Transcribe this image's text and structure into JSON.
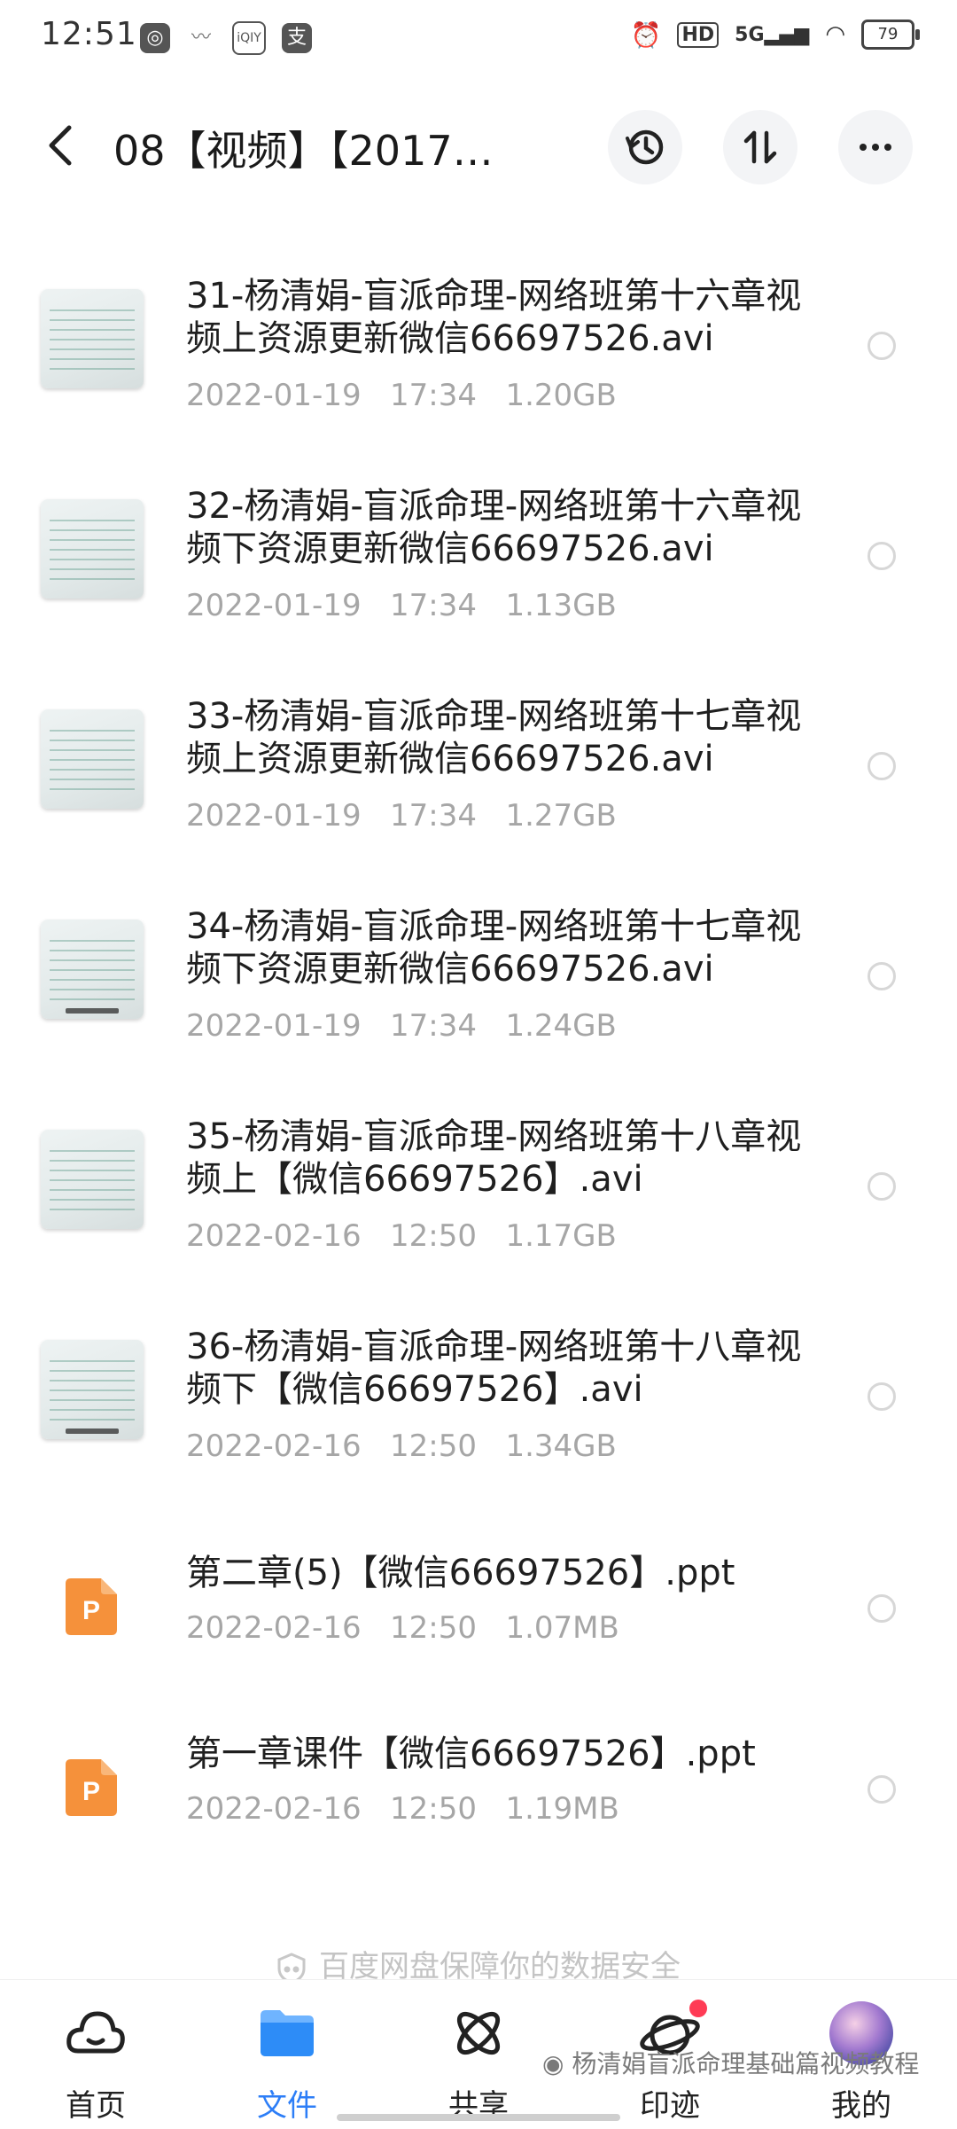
{
  "status_bar": {
    "time": "12:51",
    "left_icons": [
      "app-icon",
      "wave-icon",
      "iqiyi-icon",
      "alipay-icon"
    ],
    "network": "5G",
    "hd_label": "HD",
    "battery": "79"
  },
  "header": {
    "title": "08【视频】【2017…",
    "actions": [
      "history-icon",
      "sort-icon",
      "more-icon"
    ]
  },
  "files": [
    {
      "name": "31-杨清娟-盲派命理-网络班第十六章视频上资源更新微信66697526.avi",
      "date": "2022-01-19",
      "time": "17:34",
      "size": "1.20GB",
      "type": "video"
    },
    {
      "name": "32-杨清娟-盲派命理-网络班第十六章视频下资源更新微信66697526.avi",
      "date": "2022-01-19",
      "time": "17:34",
      "size": "1.13GB",
      "type": "video"
    },
    {
      "name": "33-杨清娟-盲派命理-网络班第十七章视频上资源更新微信66697526.avi",
      "date": "2022-01-19",
      "time": "17:34",
      "size": "1.27GB",
      "type": "video"
    },
    {
      "name": "34-杨清娟-盲派命理-网络班第十七章视频下资源更新微信66697526.avi",
      "date": "2022-01-19",
      "time": "17:34",
      "size": "1.24GB",
      "type": "video"
    },
    {
      "name": "35-杨清娟-盲派命理-网络班第十八章视频上【微信66697526】.avi",
      "date": "2022-02-16",
      "time": "12:50",
      "size": "1.17GB",
      "type": "video"
    },
    {
      "name": "36-杨清娟-盲派命理-网络班第十八章视频下【微信66697526】.avi",
      "date": "2022-02-16",
      "time": "12:50",
      "size": "1.34GB",
      "type": "video"
    },
    {
      "name": "第二章(5)【微信66697526】.ppt",
      "date": "2022-02-16",
      "time": "12:50",
      "size": "1.07MB",
      "type": "ppt"
    },
    {
      "name": "第一章课件【微信66697526】.ppt",
      "date": "2022-02-16",
      "time": "12:50",
      "size": "1.19MB",
      "type": "ppt"
    }
  ],
  "safety_text": "百度网盘保障你的数据安全",
  "nav": [
    {
      "label": "首页",
      "icon": "home-cloud-icon",
      "active": false
    },
    {
      "label": "文件",
      "icon": "folder-icon",
      "active": true
    },
    {
      "label": "共享",
      "icon": "share-atom-icon",
      "active": false
    },
    {
      "label": "印迹",
      "icon": "planet-icon",
      "active": false
    },
    {
      "label": "我的",
      "icon": "avatar",
      "active": false
    }
  ],
  "watermark": "杨清娟盲派命理基础篇视频教程",
  "colors": {
    "accent": "#2d7ef7",
    "ppt": "#f5913b",
    "meta": "#a6a6a6",
    "badge": "#ff3b55"
  }
}
